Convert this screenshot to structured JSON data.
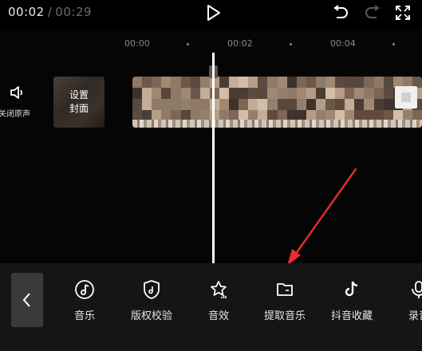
{
  "header": {
    "current_time": "00:02",
    "separator": "/",
    "total_time": "00:29"
  },
  "ruler": {
    "labels": [
      "00:00",
      "00:02",
      "00:04"
    ]
  },
  "track": {
    "mute_label": "关闭原声",
    "cover_line1": "设置",
    "cover_line2": "封面"
  },
  "toolbar": {
    "items": [
      {
        "label": "音乐",
        "icon": "music-note-icon"
      },
      {
        "label": "版权校验",
        "icon": "shield-music-icon"
      },
      {
        "label": "音效",
        "icon": "star-audio-icon"
      },
      {
        "label": "提取音乐",
        "icon": "folder-icon"
      },
      {
        "label": "抖音收藏",
        "icon": "douyin-icon"
      },
      {
        "label": "录音",
        "icon": "microphone-icon"
      }
    ]
  },
  "colors": {
    "annotation_arrow": "#e82c2c",
    "toolbar_bg": "#151515",
    "back_button_bg": "#3a3a3a"
  }
}
